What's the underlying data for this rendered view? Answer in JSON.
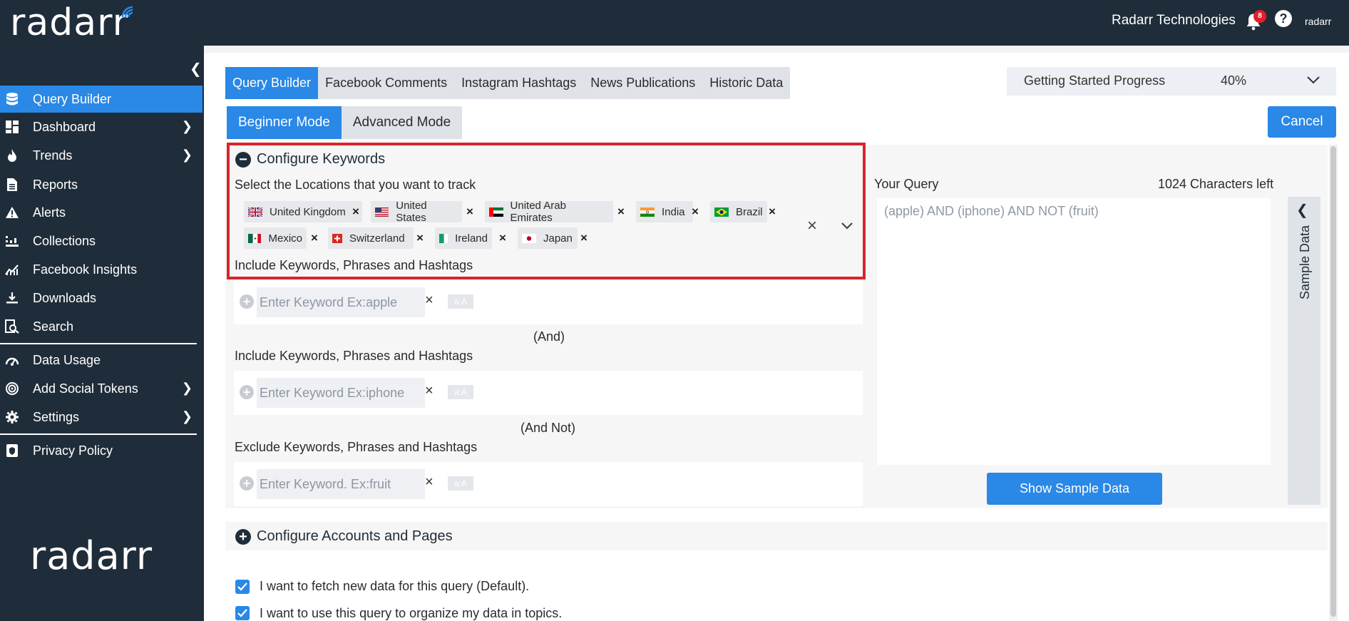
{
  "app": {
    "logo_text": "radarr",
    "org_name": "Radarr Technologies",
    "notification_count": "8",
    "help_symbol": "?",
    "mini_logo": "radarr"
  },
  "sidebar": {
    "items": [
      {
        "label": "Query Builder",
        "icon": "database-icon",
        "active": true
      },
      {
        "label": "Dashboard",
        "icon": "dashboard-icon",
        "has_submenu": true
      },
      {
        "label": "Trends",
        "icon": "fire-icon",
        "has_submenu": true
      },
      {
        "label": "Reports",
        "icon": "document-icon"
      },
      {
        "label": "Alerts",
        "icon": "warning-icon"
      },
      {
        "label": "Collections",
        "icon": "collections-icon"
      },
      {
        "label": "Facebook Insights",
        "icon": "chart-icon"
      },
      {
        "label": "Downloads",
        "icon": "download-icon"
      },
      {
        "label": "Search",
        "icon": "search-icon"
      },
      {
        "label": "Data Usage",
        "icon": "gauge-icon"
      },
      {
        "label": "Add Social Tokens",
        "icon": "target-icon",
        "has_submenu": true
      },
      {
        "label": "Settings",
        "icon": "gear-icon",
        "has_submenu": true
      },
      {
        "label": "Privacy Policy",
        "icon": "shield-icon"
      }
    ],
    "bottom_logo": "radarr"
  },
  "tabs": [
    "Query Builder",
    "Facebook Comments",
    "Instagram Hashtags",
    "News Publications",
    "Historic Data"
  ],
  "progress": {
    "label": "Getting Started Progress",
    "value": "40%"
  },
  "modes": [
    "Beginner Mode",
    "Advanced Mode"
  ],
  "cancel_label": "Cancel",
  "keywords_section": {
    "title": "Configure Keywords",
    "locations_label": "Select the Locations that you want to track",
    "locations": [
      "United Kingdom",
      "United States",
      "United Arab Emirates",
      "India",
      "Brazil",
      "Mexico",
      "Switzerland",
      "Ireland",
      "Japan"
    ],
    "include_label_1": "Include Keywords, Phrases and Hashtags",
    "keyword_placeholder_1": "Enter Keyword Ex:apple",
    "op_and": "(And)",
    "include_label_2": "Include Keywords, Phrases and Hashtags",
    "keyword_placeholder_2": "Enter Keyword Ex:iphone",
    "op_and_not": "(And Not)",
    "exclude_label": "Exclude Keywords, Phrases and Hashtags",
    "keyword_placeholder_3": "Enter Keyword. Ex:fruit",
    "case_toggle": "a:A"
  },
  "query": {
    "label": "Your Query",
    "chars_left": "1024 Characters left",
    "text": "(apple) AND (iphone) AND NOT (fruit)",
    "sample_button": "Show Sample Data",
    "sample_side_label": "Sample Data"
  },
  "accounts_section": {
    "title": "Configure Accounts and Pages"
  },
  "options": {
    "fetch_new": "I want to fetch new data for this query (Default).",
    "organize_topics": "I want to use this query to organize my data in topics."
  },
  "colors": {
    "sidebar_bg": "#1f2d3a",
    "accent": "#2a88e6",
    "highlight": "#d9252c"
  }
}
